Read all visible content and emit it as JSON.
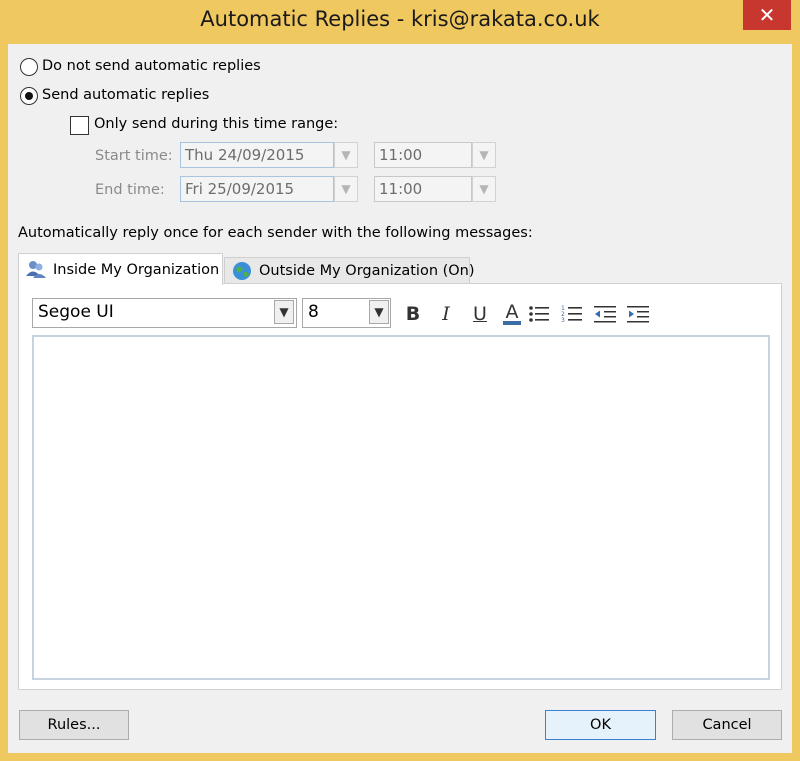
{
  "window": {
    "title": "Automatic Replies - kris@rakata.co.uk",
    "close_icon": "close-icon",
    "frame_color": "#f0c860",
    "close_color": "#c7372f"
  },
  "options": {
    "do_not_send": {
      "label": "Do not send automatic replies",
      "selected": false
    },
    "send": {
      "label": "Send automatic replies",
      "selected": true
    },
    "time_range": {
      "label": "Only send during this time range:",
      "checked": false
    }
  },
  "schedule": {
    "start_label": "Start time:",
    "start_date": "Thu 24/09/2015",
    "start_time": "11:00",
    "end_label": "End time:",
    "end_date": "Fri 25/09/2015",
    "end_time": "11:00"
  },
  "instructions": "Automatically reply once for each sender with the following messages:",
  "tabs": [
    {
      "label": "Inside My Organization",
      "icon": "people-icon",
      "active": true
    },
    {
      "label": "Outside My Organization (On)",
      "icon": "globe-icon",
      "active": false
    }
  ],
  "toolbar": {
    "font": "Segoe UI",
    "size": "8",
    "bold": "B",
    "italic": "I",
    "underline": "U",
    "font_color": "A",
    "font_color_swatch": "#3b6ea5"
  },
  "message": "",
  "buttons": {
    "rules": "Rules...",
    "ok": "OK",
    "cancel": "Cancel"
  }
}
